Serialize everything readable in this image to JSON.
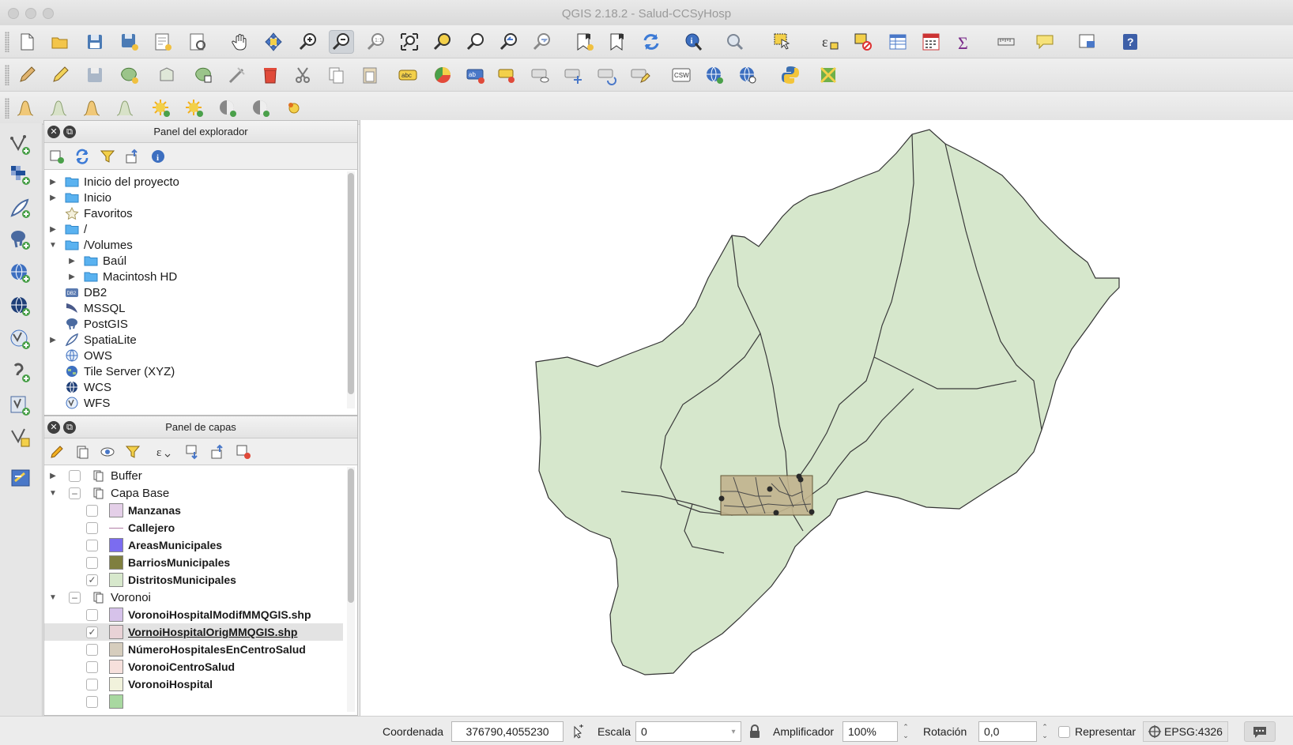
{
  "window": {
    "title": "QGIS 2.18.2 - Salud-CCSyHosp"
  },
  "toolbar_icons": [
    "new-project-icon",
    "open-project-icon",
    "save-project-icon",
    "save-as-icon",
    "new-print-composer-icon",
    "composer-manager-icon",
    "pan-icon",
    "pan-to-selection-icon",
    "zoom-in-icon",
    "zoom-out-icon",
    "zoom-native-icon",
    "zoom-full-icon",
    "zoom-to-selection-icon",
    "zoom-to-layer-icon",
    "zoom-last-icon",
    "zoom-next-icon",
    "new-bookmark-icon",
    "show-bookmarks-icon",
    "refresh-icon",
    "identify-icon",
    "map-tips-icon",
    "select-features-icon",
    "select-by-expression-icon",
    "deselect-icon",
    "attribute-table-icon",
    "field-calculator-icon",
    "statistics-icon",
    "measure-icon",
    "annotation-icon",
    "overview-icon",
    "help-icon"
  ],
  "explorer": {
    "title": "Panel del explorador",
    "items": [
      {
        "label": "Inicio del proyecto"
      },
      {
        "label": "Inicio"
      },
      {
        "label": "Favoritos"
      },
      {
        "label": "/"
      },
      {
        "label": "/Volumes"
      },
      {
        "label": "Baúl"
      },
      {
        "label": "Macintosh HD"
      },
      {
        "label": "DB2"
      },
      {
        "label": "MSSQL"
      },
      {
        "label": "PostGIS"
      },
      {
        "label": "SpatiaLite"
      },
      {
        "label": "OWS"
      },
      {
        "label": "Tile Server (XYZ)"
      },
      {
        "label": "WCS"
      },
      {
        "label": "WFS"
      }
    ]
  },
  "layers": {
    "title": "Panel de capas",
    "items": [
      {
        "label": "Buffer",
        "color": "",
        "checked": ""
      },
      {
        "label": "Capa Base",
        "color": "",
        "checked": "–"
      },
      {
        "label": "Manzanas",
        "color": "#e4cfe8",
        "checked": ""
      },
      {
        "label": "Callejero",
        "color": "#b27ea6",
        "checked": ""
      },
      {
        "label": "AreasMunicipales",
        "color": "#7b6cf0",
        "checked": ""
      },
      {
        "label": "BarriosMunicipales",
        "color": "#7f7f3f",
        "checked": ""
      },
      {
        "label": "DistritosMunicipales",
        "color": "#d7e8cc",
        "checked": "✓"
      },
      {
        "label": "Voronoi",
        "color": "",
        "checked": "–"
      },
      {
        "label": "VoronoiHospitalModifMMQGIS.shp",
        "color": "#d6c2ea",
        "checked": ""
      },
      {
        "label": "VornoiHospitalOrigMMQGIS.shp",
        "color": "#e8d2d6",
        "checked": "✓"
      },
      {
        "label": "NúmeroHospitalesEnCentroSalud",
        "color": "#d6cdbd",
        "checked": ""
      },
      {
        "label": "VoronoiCentroSalud",
        "color": "#f6e0dc",
        "checked": ""
      },
      {
        "label": "VoronoiHospital",
        "color": "#f1f2dc",
        "checked": ""
      }
    ]
  },
  "statusbar": {
    "coord_label": "Coordenada",
    "coord_value": "376790,4055230",
    "scale_label": "Escala",
    "scale_value": "0",
    "magnifier_label": "Amplificador",
    "magnifier_value": "100%",
    "rotation_label": "Rotación",
    "rotation_value": "0,0",
    "render_label": "Representar",
    "crs": "EPSG:4326"
  },
  "map": {
    "fill_color": "#d6e7cc",
    "stroke_color": "#333333",
    "selection_color": "#c2b48e"
  }
}
